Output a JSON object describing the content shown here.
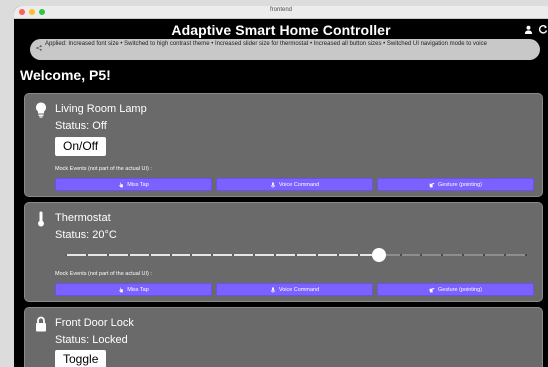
{
  "window": {
    "title": "frontend"
  },
  "header": {
    "title": "Adaptive Smart Home Controller"
  },
  "notification": {
    "text": "Applied: Increased font size • Switched to high contrast theme • Increased slider size for thermostat • Increased all button sizes • Switched UI navigation mode to voice"
  },
  "welcome": "Welcome, P5!",
  "mock_events_label": "Mock Events (not part of the actual UI) :",
  "mock_buttons": {
    "miss_tap": "Miss Tap",
    "voice": "Voice Command",
    "gesture": "Gesture (pointing)"
  },
  "devices": [
    {
      "name": "Living Room Lamp",
      "status": "Status: Off",
      "action": "On/Off",
      "icon": "lightbulb-icon"
    },
    {
      "name": "Thermostat",
      "status": "Status: 20°C",
      "icon": "thermometer-icon",
      "slider_fraction": 0.68
    },
    {
      "name": "Front Door Lock",
      "status": "Status: Locked",
      "action": "Toggle",
      "icon": "lock-icon"
    }
  ],
  "colors": {
    "accent": "#7b61ff",
    "card": "#6a6a6a",
    "background": "#000000"
  }
}
